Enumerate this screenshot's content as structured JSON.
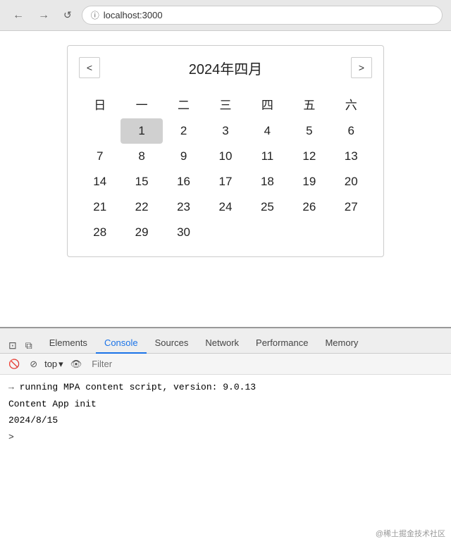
{
  "browser": {
    "url": "localhost:3000",
    "back_label": "←",
    "forward_label": "→",
    "refresh_label": "↺",
    "info_icon": "ⓘ"
  },
  "calendar": {
    "title": "2024年四月",
    "prev_label": "<",
    "next_label": ">",
    "weekdays": [
      "日",
      "一",
      "二",
      "三",
      "四",
      "五",
      "六"
    ],
    "weeks": [
      [
        null,
        1,
        2,
        3,
        4,
        5,
        6
      ],
      [
        7,
        8,
        9,
        10,
        11,
        12,
        13
      ],
      [
        14,
        15,
        16,
        17,
        18,
        19,
        20
      ],
      [
        21,
        22,
        23,
        24,
        25,
        26,
        27
      ],
      [
        28,
        29,
        30,
        null,
        null,
        null,
        null
      ]
    ],
    "today": 1
  },
  "devtools": {
    "tabs": [
      {
        "label": "Elements",
        "active": false
      },
      {
        "label": "Console",
        "active": true
      },
      {
        "label": "Sources",
        "active": false
      },
      {
        "label": "Network",
        "active": false
      },
      {
        "label": "Performance",
        "active": false
      },
      {
        "label": "Memory",
        "active": false
      }
    ],
    "toolbar": {
      "top_label": "top",
      "filter_placeholder": "Filter"
    },
    "console_lines": [
      {
        "type": "arrow",
        "text": "running MPA content script, version: 9.0.13"
      },
      {
        "type": "normal",
        "text": "Content App init"
      },
      {
        "type": "normal",
        "text": "2024/8/15"
      },
      {
        "type": "prompt",
        "text": ""
      }
    ]
  },
  "watermark": "@稀土掘金技术社区"
}
